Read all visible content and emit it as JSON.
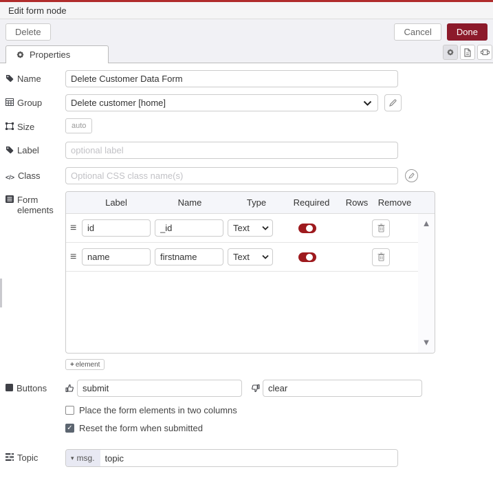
{
  "colors": {
    "top_bar": "#b02c2c",
    "done_button": "#8c1a2b",
    "toggle_on": "#9e1a1e",
    "toolbar_bg": "#f1f1f5"
  },
  "header": {
    "title": "Edit form node"
  },
  "toolbar": {
    "delete": "Delete",
    "cancel": "Cancel",
    "done": "Done"
  },
  "tab_bar": {
    "properties": "Properties"
  },
  "fields": {
    "name": {
      "label": "Name",
      "value": "Delete Customer Data Form"
    },
    "group": {
      "label": "Group",
      "value": "Delete customer [home]"
    },
    "size": {
      "label": "Size",
      "value": "auto"
    },
    "label": {
      "label": "Label",
      "placeholder": "optional label"
    },
    "css_class": {
      "label": "Class",
      "placeholder": "Optional CSS class name(s)"
    },
    "form_elements": {
      "label_line1": "Form",
      "label_line2": "elements"
    },
    "buttons": {
      "label": "Buttons",
      "submit": "submit",
      "clear": "clear"
    },
    "topic": {
      "label": "Topic",
      "prefix": "msg.",
      "value": "topic"
    }
  },
  "elements_table": {
    "headers": [
      "Label",
      "Name",
      "Type",
      "Required",
      "Rows",
      "Remove"
    ],
    "rows": [
      {
        "label": "id",
        "name": "_id",
        "type": "Text",
        "required": true
      },
      {
        "label": "name",
        "name": "firstname",
        "type": "Text",
        "required": true
      }
    ],
    "add_button": "element"
  },
  "options": [
    {
      "label": "Place the form elements in two columns",
      "checked": false
    },
    {
      "label": "Reset the form when submitted",
      "checked": true
    }
  ],
  "icons": {
    "drag_handle": "≡",
    "caret_down": "▾",
    "scroll_up": "▲",
    "scroll_down": "▼",
    "plus": "+",
    "check": "✓",
    "code": "</>"
  }
}
